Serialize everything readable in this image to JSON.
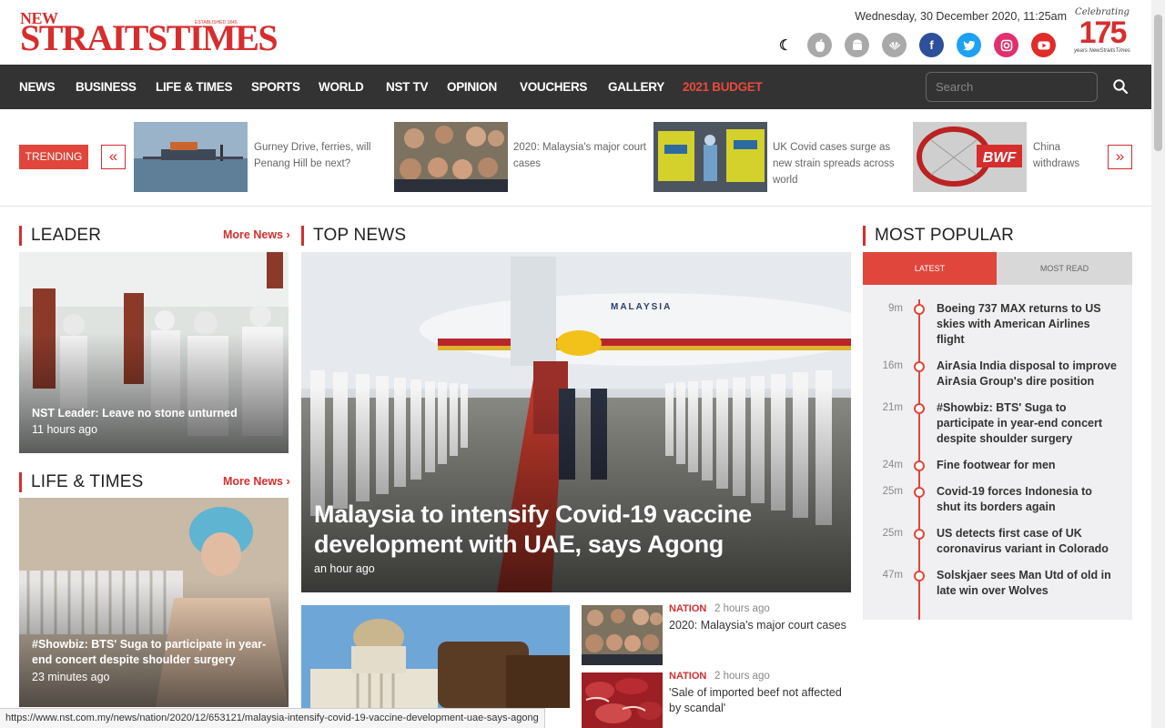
{
  "header": {
    "logo_top": "NEW",
    "logo_main": "STRAITSTIMES",
    "logo_est": "ESTABLISHED 1845",
    "date": "Wednesday, 30 December 2020, 11:25am",
    "anniversary_top": "Celebrating",
    "anniversary_num": "175",
    "anniversary_bottom": "years NewStraitsTimes",
    "icons": [
      "moon-icon",
      "apple-icon",
      "android-icon",
      "huawei-icon",
      "facebook-icon",
      "twitter-icon",
      "instagram-icon",
      "youtube-icon"
    ]
  },
  "nav": {
    "items": [
      "NEWS",
      "BUSINESS",
      "LIFE & TIMES",
      "SPORTS",
      "WORLD",
      "NST TV",
      "OPINION",
      "VOUCHERS",
      "GALLERY",
      "2021 BUDGET"
    ],
    "search_placeholder": "Search"
  },
  "trending": {
    "label": "TRENDING",
    "prev": "«",
    "next": "»",
    "items": [
      {
        "title": "Gurney Drive, ferries, will Penang Hill be next?"
      },
      {
        "title": "2020: Malaysia's major court cases"
      },
      {
        "title": "UK Covid cases surge as new strain spreads across world"
      },
      {
        "title": "China withdraws from World Tour tou..."
      }
    ]
  },
  "leader": {
    "heading": "LEADER",
    "more": "More News ›",
    "caption": "NST Leader: Leave no stone unturned",
    "time": "11 hours ago"
  },
  "life_times": {
    "heading": "LIFE & TIMES",
    "more": "More News ›",
    "caption": "#Showbiz: BTS' Suga to participate in year-end concert despite shoulder surgery",
    "time": "23 minutes ago"
  },
  "top_news": {
    "heading": "TOP NEWS",
    "headline": "Malaysia to intensify Covid-19 vaccine development with UAE, says Agong",
    "time": "an hour ago",
    "plane_text": "MALAYSIA",
    "small": [
      {
        "category": "NATION",
        "time": "2 hours ago",
        "title": "2020: Malaysia's major court cases"
      },
      {
        "category": "NATION",
        "time": "2 hours ago",
        "title": "'Sale of imported beef not affected by scandal'"
      }
    ]
  },
  "most_popular": {
    "heading": "MOST POPULAR",
    "tab_latest": "LATEST",
    "tab_most_read": "MOST READ",
    "items": [
      {
        "time": "9m",
        "title": "Boeing 737 MAX returns to US skies with American Airlines flight"
      },
      {
        "time": "16m",
        "title": "AirAsia India disposal to improve AirAsia Group's dire position"
      },
      {
        "time": "21m",
        "title": "#Showbiz: BTS' Suga to participate in year-end concert despite shoulder surgery"
      },
      {
        "time": "24m",
        "title": "Fine footwear for men"
      },
      {
        "time": "25m",
        "title": "Covid-19 forces Indonesia to shut its borders again"
      },
      {
        "time": "25m",
        "title": "US detects first case of UK coronavirus variant in Colorado"
      },
      {
        "time": "47m",
        "title": "Solskjaer sees Man Utd of old in late win over Wolves"
      }
    ]
  },
  "status_url": "https://www.nst.com.my/news/nation/2020/12/653121/malaysia-intensify-covid-19-vaccine-development-uae-says-agong"
}
